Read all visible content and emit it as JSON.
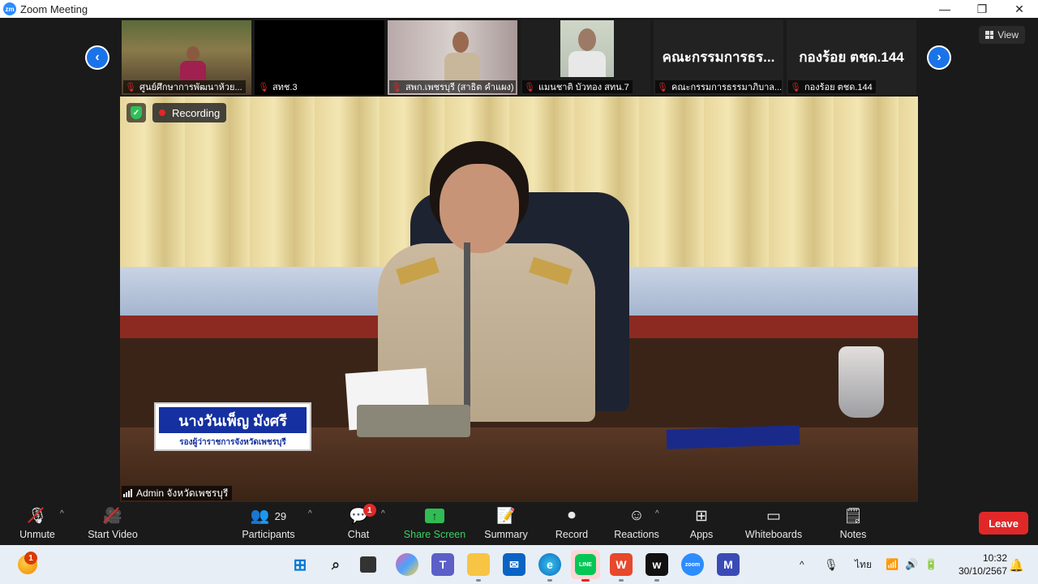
{
  "window": {
    "logo_text": "zm",
    "title": "Zoom Meeting",
    "minimize": "—",
    "maximize": "❐",
    "close": "✕"
  },
  "view_button": {
    "label": "View"
  },
  "participants_strip": [
    {
      "label": "ศูนย์ศึกษาการพัฒนาห้วย...",
      "muted": true,
      "big_name": ""
    },
    {
      "label": "สทช.3",
      "muted": true,
      "big_name": ""
    },
    {
      "label": "สพก.เพชรบุรี (สาธิต คำแผง)",
      "muted": true,
      "big_name": ""
    },
    {
      "label": "แมนชาติ บัวทอง สทน.7",
      "muted": true,
      "big_name": ""
    },
    {
      "label": "คณะกรรมการธรรมาภิบาล...",
      "muted": true,
      "big_name": "คณะกรรมการธร..."
    },
    {
      "label": "กองร้อย ตชด.144",
      "muted": true,
      "big_name": "กองร้อย ตชด.144"
    }
  ],
  "main_video": {
    "recording_label": "Recording",
    "speaker_name": "Admin จังหวัดเพชรบุรี",
    "nameplate_name": "นางวันเพ็ญ มังศรี",
    "nameplate_title": "รองผู้ว่าราชการจังหวัดเพชรบุรี"
  },
  "toolbar": {
    "unmute": "Unmute",
    "start_video": "Start Video",
    "participants": "Participants",
    "participants_count": "29",
    "chat": "Chat",
    "chat_badge": "1",
    "share_screen": "Share Screen",
    "summary": "Summary",
    "record": "Record",
    "reactions": "Reactions",
    "apps": "Apps",
    "whiteboards": "Whiteboards",
    "notes": "Notes",
    "leave": "Leave"
  },
  "taskbar": {
    "weather_badge": "1",
    "language": "ไทย",
    "time": "10:32",
    "date": "30/10/2567",
    "line_label": "LINE",
    "zoom_label": "zoom"
  },
  "colors": {
    "accent_blue": "#1a73e8",
    "leave_red": "#e02828",
    "share_green": "#2fbd54"
  }
}
